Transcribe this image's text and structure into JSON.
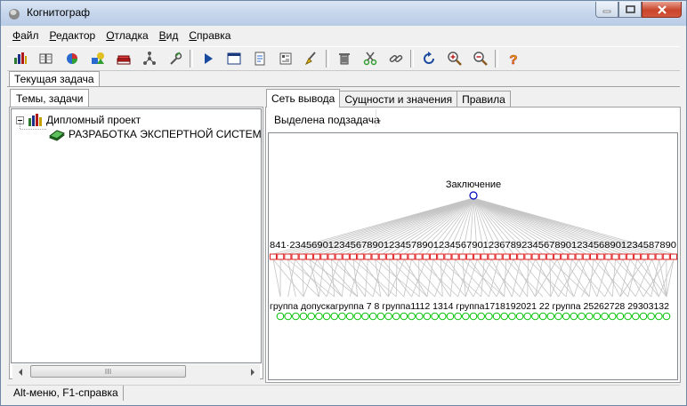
{
  "window": {
    "title": "Когнитограф"
  },
  "menu": [
    {
      "accel": "Ф",
      "rest": "айл"
    },
    {
      "accel": "Р",
      "rest": "едактор"
    },
    {
      "accel": "О",
      "rest": "тладка"
    },
    {
      "accel": "В",
      "rest": "ид"
    },
    {
      "accel": "С",
      "rest": "правка"
    }
  ],
  "toolbar": {
    "groups": [
      [
        "chart-icon",
        "book-icon",
        "pie-icon",
        "shapes-icon",
        "books-icon",
        "tree-icon",
        "wrench-icon"
      ],
      [
        "play-icon",
        "window-icon",
        "document-icon",
        "properties-icon",
        "brush-icon"
      ],
      [
        "trash-icon",
        "cut-icon",
        "link-icon"
      ],
      [
        "refresh-icon",
        "zoom-in-icon",
        "zoom-out-icon"
      ],
      [
        "help-icon"
      ]
    ]
  },
  "task_tab": "Текущая задача",
  "left_tab": "Темы, задачи",
  "tree": {
    "root": "Дипломный проект",
    "child": "РАЗРАБОТКА ЭКСПЕРТНОЙ СИСТЕМЫ"
  },
  "right_tabs": [
    "Сеть вывода",
    "Сущности и значения",
    "Правила"
  ],
  "subtask": {
    "label": "Выделена подзадача",
    "value": "-"
  },
  "network": {
    "conclusion": "Заключение",
    "middle_numbers": "841·2345690123456789012345789012345679012367892345678901234568901234587890",
    "bottom_labels": "группа допускагруппа 7 8 группа1112 1314 группа1718192021 22 группа 25262728 29303132",
    "middle_count": 56,
    "bottom_count": 51,
    "colors": {
      "top": "#0000c0",
      "middle": "#e02020",
      "bottom": "#00c000",
      "edge": "#c4c4c4"
    }
  },
  "status": "Alt-меню,  F1-справка"
}
